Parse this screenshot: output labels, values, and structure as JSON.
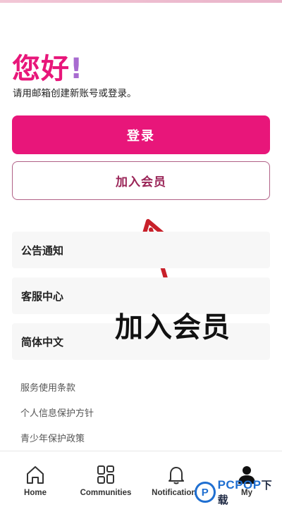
{
  "greeting": {
    "text": "您好",
    "mark": "!"
  },
  "subtitle": "请用邮箱创建新账号或登录。",
  "buttons": {
    "login": "登录",
    "join": "加入会员"
  },
  "menu": [
    {
      "label": "公告通知"
    },
    {
      "label": "客服中心"
    },
    {
      "label": "简体中文"
    }
  ],
  "links": [
    "服务使用条款",
    "个人信息保护方针",
    "青少年保护政策"
  ],
  "overlay_caption": "加入会员",
  "tabbar": [
    {
      "label": "Home",
      "icon": "home-icon"
    },
    {
      "label": "Communities",
      "icon": "communities-icon"
    },
    {
      "label": "Notifications",
      "icon": "bell-icon"
    },
    {
      "label": "My",
      "icon": "profile-icon"
    }
  ],
  "watermark": {
    "logo_letter": "P",
    "brand": "PCPOP",
    "suffix": "下载"
  },
  "colors": {
    "accent": "#e8167a",
    "join_border": "#b06086",
    "arrow": "#c8202a"
  }
}
